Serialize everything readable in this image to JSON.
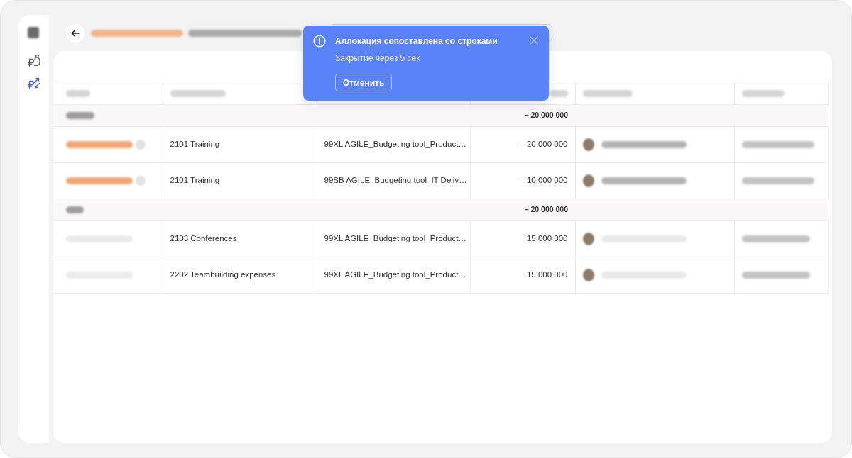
{
  "sidebar": {
    "items": [
      {
        "selected": false
      },
      {
        "selected": true
      }
    ]
  },
  "toast": {
    "title": "Аллокация сопоставлена со строками",
    "message": "Закрытие через 5 сек",
    "action": "Отменить"
  },
  "table": {
    "groups": [
      {
        "total": "– 20 000 000",
        "rows": [
          {
            "status": {
              "color": "#f2a676",
              "info_icon": true
            },
            "category": "2101 Training",
            "project": "99XL AGILE_Budgeting tool_Product…",
            "amount": "– 20 000 000",
            "approver": {
              "dimmed": false
            }
          },
          {
            "status": {
              "color": "#f2a676",
              "info_icon": true
            },
            "category": "2101 Training",
            "project": "99SB AGILE_Budgeting tool_IT Deliv…",
            "amount": "– 10 000 000",
            "approver": {
              "dimmed": false
            }
          }
        ]
      },
      {
        "total": "– 20 000 000",
        "rows": [
          {
            "status": {
              "color": "#ebebeb",
              "info_icon": false
            },
            "category": "2103 Conferences",
            "project": "99XL AGILE_Budgeting tool_Product…",
            "amount": "15 000 000",
            "approver": {
              "dimmed": true
            }
          },
          {
            "status": {
              "color": "#ebebeb",
              "info_icon": false
            },
            "category": "2202 Teambuilding expenses",
            "project": "99XL AGILE_Budgeting tool_Product…",
            "amount": "15 000 000",
            "approver": {
              "dimmed": true
            }
          }
        ]
      }
    ]
  }
}
